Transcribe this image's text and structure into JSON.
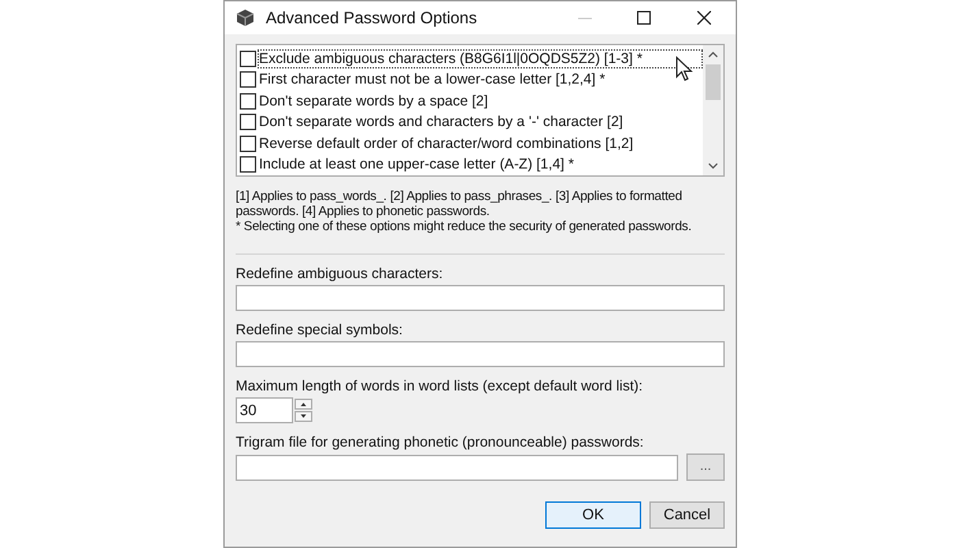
{
  "window": {
    "title": "Advanced Password Options"
  },
  "options": [
    {
      "label": "Exclude ambiguous characters (B8G6I1l|0OQDS5Z2) [1-3] *",
      "checked": false,
      "focused": true
    },
    {
      "label": "First character must not be a lower-case letter [1,2,4] *",
      "checked": false,
      "focused": false
    },
    {
      "label": "Don't separate words by a space [2]",
      "checked": false,
      "focused": false
    },
    {
      "label": "Don't separate words and characters by a '-' character [2]",
      "checked": false,
      "focused": false
    },
    {
      "label": "Reverse default order of character/word combinations [1,2]",
      "checked": false,
      "focused": false
    },
    {
      "label": "Include at least one upper-case letter (A-Z) [1,4] *",
      "checked": false,
      "focused": false
    }
  ],
  "note": [
    "[1] Applies to pass_words_. [2] Applies to pass_phrases_. [3] Applies to formatted passwords. [4] Applies to phonetic passwords.",
    "* Selecting one of these options might reduce the security of generated passwords."
  ],
  "fields": [
    {
      "kind": "text",
      "label": "Redefine ambiguous characters:"
    },
    {
      "kind": "text",
      "label": "Redefine special symbols:"
    },
    {
      "kind": "spin",
      "label": "Maximum length of words in word lists (except default word list):",
      "value": "30"
    },
    {
      "kind": "file",
      "label": "Trigram file for generating phonetic (pronounceable) passwords:",
      "browse": "..."
    }
  ],
  "buttons": [
    {
      "label": "OK",
      "default": true
    },
    {
      "label": "Cancel",
      "default": false
    }
  ]
}
